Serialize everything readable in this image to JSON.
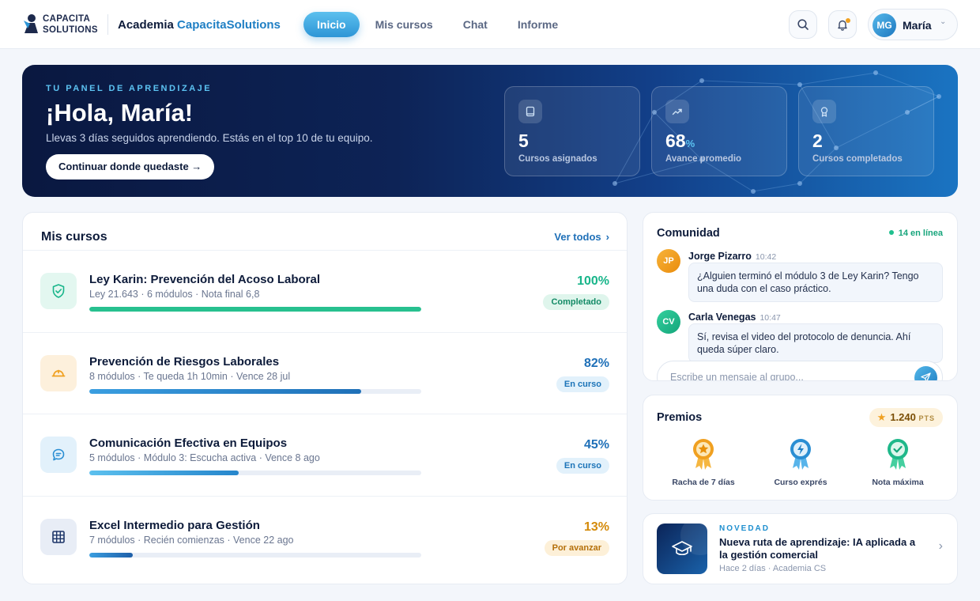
{
  "logo": {
    "line1": "CAPACITA",
    "line2": "SOLUTIONS"
  },
  "brand": {
    "prefix": "Academia",
    "accent": "CapacitaSolutions"
  },
  "nav": [
    {
      "label": "Inicio",
      "active": true
    },
    {
      "label": "Mis cursos",
      "active": false
    },
    {
      "label": "Chat",
      "active": false
    },
    {
      "label": "Informe",
      "active": false
    }
  ],
  "user": {
    "initials": "MG",
    "name": "María"
  },
  "hero": {
    "eyebrow": "TU PANEL DE APRENDIZAJE",
    "title": "¡Hola, María!",
    "subtitle": "Llevas 3 días seguidos aprendiendo. Estás en el top 10 de tu equipo.",
    "cta": "Continuar donde quedaste →",
    "stats": [
      {
        "icon": "book-icon",
        "value": "5",
        "suffix": "",
        "label": "Cursos asignados"
      },
      {
        "icon": "trend-up-icon",
        "value": "68",
        "suffix": "%",
        "label": "Avance promedio"
      },
      {
        "icon": "award-icon",
        "value": "2",
        "suffix": "",
        "label": "Cursos completados"
      }
    ]
  },
  "courses": {
    "title": "Mis cursos",
    "view_all": "Ver todos",
    "items": [
      {
        "name": "Ley Karin: Prevención del Acoso Laboral",
        "meta": "Ley 21.643 · 6 módulos · Nota final 6,8",
        "progress": 100,
        "pct": "100%",
        "status": "Completado",
        "icon": "shield-check-icon",
        "color": "#18b58a",
        "tint": "#e3f7f0",
        "badge_bg": "#dff5ec",
        "badge_fg": "#138a66",
        "bar": "#27c08f"
      },
      {
        "name": "Prevención de Riesgos Laborales",
        "meta": "8 módulos · Te queda 1h 10min · Vence 28 jul",
        "progress": 82,
        "pct": "82%",
        "status": "En curso",
        "icon": "hard-hat-icon",
        "color": "#f0a020",
        "tint": "#fdf0dc",
        "badge_bg": "#e2f1fb",
        "badge_fg": "#1c74b8",
        "bar": "#2a86c9"
      },
      {
        "name": "Comunicación Efectiva en Equipos",
        "meta": "5 módulos · Módulo 3: Escucha activa · Vence 8 ago",
        "progress": 45,
        "pct": "45%",
        "status": "En curso",
        "icon": "chat-bubble-icon",
        "color": "#2a8ed3",
        "tint": "#e2f1fb",
        "badge_bg": "#e2f1fb",
        "badge_fg": "#1c74b8",
        "bar": "#3a9ee0"
      },
      {
        "name": "Excel Intermedio para Gestión",
        "meta": "7 módulos · Recién comienzas · Vence 22 ago",
        "progress": 13,
        "pct": "13%",
        "status": "Por avanzar",
        "icon": "grid-icon",
        "color": "#1d3568",
        "tint": "#e8edf6",
        "badge_bg": "#fdf0d8",
        "badge_fg": "#b5700a",
        "bar": "#1f70b8"
      }
    ]
  },
  "community": {
    "title": "Comunidad",
    "online": "14 en línea",
    "messages": [
      {
        "initials": "JP",
        "name": "Jorge Pizarro",
        "time": "10:42",
        "text": "¿Alguien terminó el módulo 3 de Ley Karin? Tengo una duda con el caso práctico.",
        "color": "#f0a020"
      },
      {
        "initials": "CV",
        "name": "Carla Venegas",
        "time": "10:47",
        "text": "Sí, revisa el video del protocolo de denuncia. Ahí queda súper claro.",
        "color": "#1fb88a"
      }
    ],
    "placeholder": "Escribe un mensaje al grupo..."
  },
  "rewards": {
    "title": "Premios",
    "points": "1.240",
    "points_unit": "PTS",
    "items": [
      {
        "label": "Racha de 7 días",
        "icon": "star-medal-icon",
        "color": "#f0a020"
      },
      {
        "label": "Curso exprés",
        "icon": "bolt-medal-icon",
        "color": "#2a8ed3"
      },
      {
        "label": "Nota máxima",
        "icon": "check-medal-icon",
        "color": "#1fb88a"
      }
    ]
  },
  "news": {
    "eyebrow": "NOVEDAD",
    "title": "Nueva ruta de aprendizaje: IA aplicada a la gestión comercial",
    "meta": "Hace 2 días · Academia CS"
  }
}
